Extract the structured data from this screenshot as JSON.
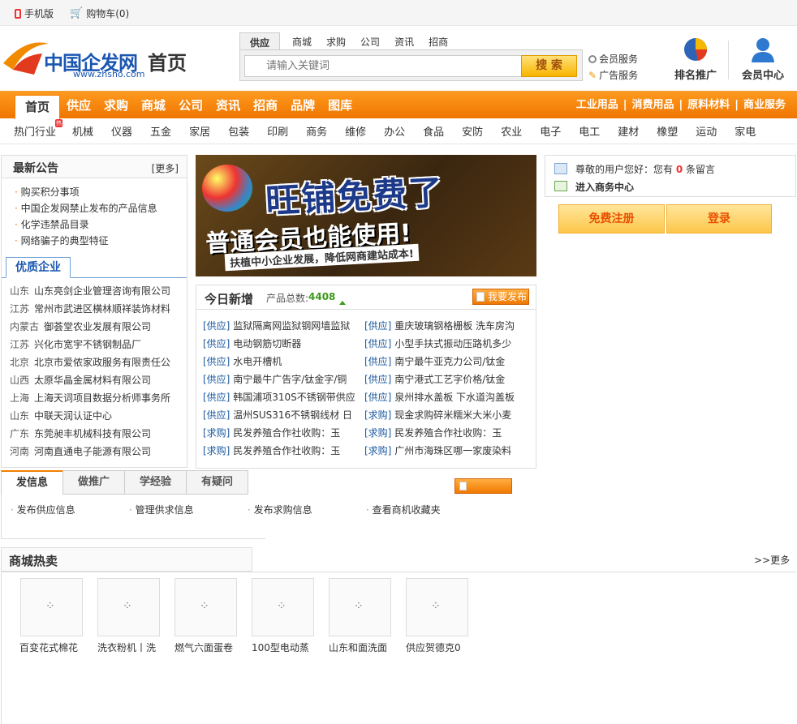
{
  "topbar": {
    "mobile": "手机版",
    "cart": "购物车(0)"
  },
  "logo": {
    "brand": "中国企发网",
    "home": "首页",
    "url": "www.zhsho.com"
  },
  "search": {
    "tabs": [
      "供应",
      "商城",
      "求购",
      "公司",
      "资讯",
      "招商"
    ],
    "placeholder": "请输入关键词",
    "button": "搜 索"
  },
  "services": {
    "member": "会员服务",
    "ad": "广告服务"
  },
  "header_icons": {
    "rank": "排名推广",
    "center": "会员中心"
  },
  "nav": {
    "items": [
      "首页",
      "供应",
      "求购",
      "商城",
      "公司",
      "资讯",
      "招商",
      "品牌",
      "图库"
    ],
    "right": [
      "工业用品",
      "消费用品",
      "原料材料",
      "商业服务"
    ]
  },
  "categories": {
    "hot": "热门行业",
    "items": [
      "机械",
      "仪器",
      "五金",
      "家居",
      "包装",
      "印刷",
      "商务",
      "维修",
      "办公",
      "食品",
      "安防",
      "农业",
      "电子",
      "电工",
      "建材",
      "橡塑",
      "运动",
      "家电"
    ]
  },
  "notice": {
    "title": "最新公告",
    "more": "[更多]",
    "items": [
      "购买积分事项",
      "中国企发网禁止发布的产品信息",
      "化学违禁品目录",
      "网络骗子的典型特征"
    ]
  },
  "enterprise": {
    "title": "优质企业",
    "items": [
      {
        "region": "山东",
        "name": "山东亮剑企业管理咨询有限公司"
      },
      {
        "region": "江苏",
        "name": "常州市武进区横林顺祥装饰材料"
      },
      {
        "region": "内蒙古",
        "name": "御荟堂农业发展有限公司"
      },
      {
        "region": "江苏",
        "name": "兴化市宽宇不锈钢制品厂"
      },
      {
        "region": "北京",
        "name": "北京市爱侬家政服务有限责任公"
      },
      {
        "region": "山西",
        "name": "太原华晶金属材料有限公司"
      },
      {
        "region": "上海",
        "name": "上海天词项目数据分析师事务所"
      },
      {
        "region": "山东",
        "name": "中联天润认证中心"
      },
      {
        "region": "广东",
        "name": "东莞昶丰机械科技有限公司"
      },
      {
        "region": "河南",
        "name": "河南直通电子能源有限公司"
      }
    ]
  },
  "banner": {
    "line1": "旺铺免费了",
    "line2": "普通会员也能使用!",
    "line3": "扶植中小企业发展，降低网商建站成本!"
  },
  "today": {
    "title": "今日新增",
    "total_label": "产品总数:",
    "total": "4408",
    "publish": "我要发布",
    "left": [
      {
        "tag": "[供应]",
        "text": "监狱隔离网监狱钢网墙监狱"
      },
      {
        "tag": "[供应]",
        "text": "电动钢筋切断器"
      },
      {
        "tag": "[供应]",
        "text": "水电开槽机"
      },
      {
        "tag": "[供应]",
        "text": "南宁最牛广告字/钛金字/铜"
      },
      {
        "tag": "[供应]",
        "text": "韩国浦项310S不锈钢带供应"
      },
      {
        "tag": "[供应]",
        "text": "温州SUS316不锈钢线材 日"
      },
      {
        "tag": "[求购]",
        "text": "民发养殖合作社收购：玉"
      },
      {
        "tag": "[求购]",
        "text": "民发养殖合作社收购：玉"
      }
    ],
    "right": [
      {
        "tag": "[供应]",
        "text": "重庆玻璃钢格栅板 洗车房沟"
      },
      {
        "tag": "[供应]",
        "text": "小型手扶式振动压路机多少"
      },
      {
        "tag": "[供应]",
        "text": "南宁最牛亚克力公司/钛金"
      },
      {
        "tag": "[供应]",
        "text": "南宁港式工艺字价格/钛金"
      },
      {
        "tag": "[供应]",
        "text": "泉州排水盖板 下水道沟盖板"
      },
      {
        "tag": "[求购]",
        "text": "现金求购碎米糯米大米小麦"
      },
      {
        "tag": "[求购]",
        "text": "民发养殖合作社收购：玉"
      },
      {
        "tag": "[求购]",
        "text": "广州市海珠区哪一家废染料"
      }
    ]
  },
  "user": {
    "greet_pre": "尊敬的用户您好：您有",
    "count": "0",
    "greet_post": "条留言",
    "enter": "进入商务中心",
    "register": "免费注册",
    "login": "登录"
  },
  "btabs": {
    "tabs": [
      "发信息",
      "做推广",
      "学经验",
      "有疑问"
    ],
    "links": [
      "发布供应信息",
      "管理供求信息",
      "发布求购信息",
      "查看商机收藏夹"
    ]
  },
  "mall": {
    "title": "商城热卖",
    "more": ">>更多",
    "items": [
      "百变花式棉花",
      "洗衣粉机丨洗",
      "燃气六面蛋卷",
      "100型电动蒸",
      "山东和面洗面",
      "供应贺德克0"
    ]
  }
}
